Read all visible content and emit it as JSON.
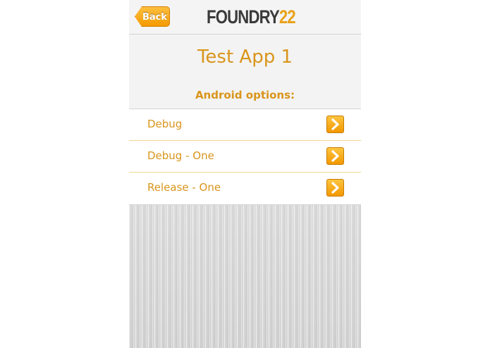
{
  "navbar": {
    "back_label": "Back",
    "logo_part1": "FOUNDRY",
    "logo_part2": "22"
  },
  "page": {
    "title": "Test App 1",
    "section_label": "Android options:"
  },
  "options": [
    {
      "label": "Debug",
      "icon": "chevron-right-icon"
    },
    {
      "label": "Debug - One",
      "icon": "chevron-right-icon"
    },
    {
      "label": "Release - One",
      "icon": "chevron-right-icon"
    }
  ],
  "colors": {
    "accent": "#d9951c",
    "button_orange": "#f39a00",
    "logo_dark": "#3a3a3a"
  }
}
